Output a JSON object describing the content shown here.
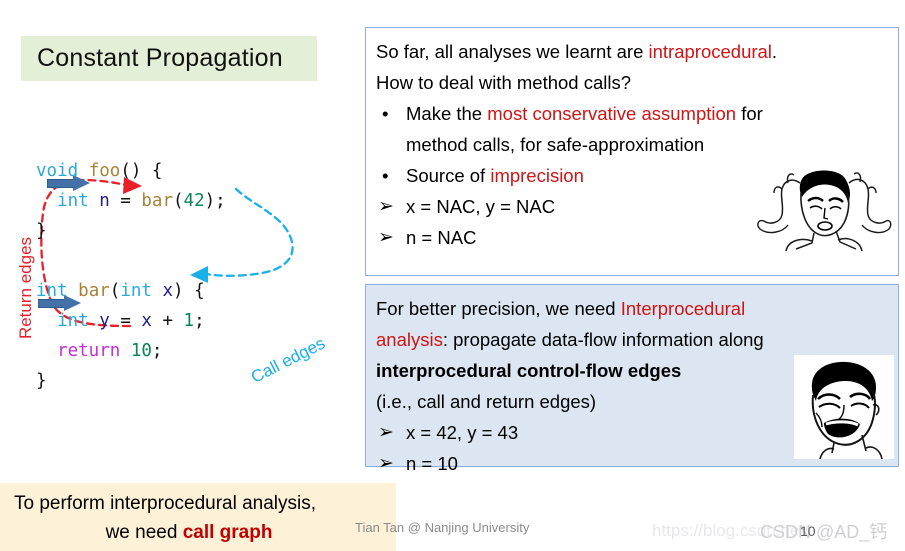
{
  "slide": {
    "title": "Constant Propagation",
    "page_number": "10"
  },
  "code": {
    "lines": [
      {
        "tokens": [
          {
            "t": "void",
            "c": "kw"
          },
          {
            "t": " ",
            "c": "pl"
          },
          {
            "t": "foo",
            "c": "fn"
          },
          {
            "t": "() {",
            "c": "pl"
          }
        ]
      },
      {
        "tokens": [
          {
            "t": "int",
            "c": "kw"
          },
          {
            "t": " ",
            "c": "pl"
          },
          {
            "t": "n",
            "c": "var"
          },
          {
            "t": " = ",
            "c": "pl"
          },
          {
            "t": "bar",
            "c": "fn"
          },
          {
            "t": "(",
            "c": "pl"
          },
          {
            "t": "42",
            "c": "num"
          },
          {
            "t": ");",
            "c": "pl"
          }
        ]
      },
      {
        "tokens": [
          {
            "t": "}",
            "c": "pl"
          }
        ]
      },
      {
        "tokens": []
      },
      {
        "tokens": [
          {
            "t": "int",
            "c": "kw"
          },
          {
            "t": " ",
            "c": "pl"
          },
          {
            "t": "bar",
            "c": "fn"
          },
          {
            "t": "(",
            "c": "pl"
          },
          {
            "t": "int",
            "c": "kw"
          },
          {
            "t": " ",
            "c": "pl"
          },
          {
            "t": "x",
            "c": "var"
          },
          {
            "t": ") {",
            "c": "pl"
          }
        ]
      },
      {
        "tokens": [
          {
            "t": "int",
            "c": "kw"
          },
          {
            "t": " ",
            "c": "pl"
          },
          {
            "t": "y",
            "c": "var"
          },
          {
            "t": " = ",
            "c": "pl"
          },
          {
            "t": "x",
            "c": "var"
          },
          {
            "t": " + ",
            "c": "pl"
          },
          {
            "t": "1",
            "c": "num"
          },
          {
            "t": ";",
            "c": "pl"
          }
        ]
      },
      {
        "tokens": [
          {
            "t": "return",
            "c": "ret"
          },
          {
            "t": " ",
            "c": "pl"
          },
          {
            "t": "10",
            "c": "num"
          },
          {
            "t": ";",
            "c": "pl"
          }
        ]
      },
      {
        "tokens": [
          {
            "t": "}",
            "c": "pl"
          }
        ]
      }
    ],
    "return_edges_label": "Return edges",
    "call_edges_label": "Call edges",
    "return_edge_color": "#e8202a",
    "call_edge_color": "#18b0e8",
    "step_arrow_color": "#4472a8"
  },
  "box_intraprocedural": {
    "line1_a": "So far, all analyses we learnt are ",
    "line1_red": "intraprocedural",
    "line1_b": ".",
    "line2": "How to deal with method calls?",
    "bullets": [
      {
        "mark": "•",
        "mark_type": "dot",
        "text_a": "Make the ",
        "text_red": "most conservative assumption",
        "text_b": " for",
        "text_cont": "method calls, for safe-approximation"
      },
      {
        "mark": "•",
        "mark_type": "dot",
        "text_a": "Source of ",
        "text_red": "imprecision",
        "text_b": "",
        "text_cont": ""
      }
    ],
    "results": [
      {
        "mark": "➢",
        "text": "x = NAC, y = NAC"
      },
      {
        "mark": "➢",
        "text": "n = NAC"
      }
    ],
    "meme": "confused-jackie-chan-face"
  },
  "box_interprocedural": {
    "line1_a": "For better precision, we need ",
    "line1_red": "Interprocedural",
    "line2_red": "analysis",
    "line2_b": ": propagate data-flow information along",
    "line3_bold": "interprocedural control-flow edges",
    "line4": "(i.e., call and return edges)",
    "results": [
      {
        "mark": "➢",
        "text": "x = 42, y = 43"
      },
      {
        "mark": "➢",
        "text": "n = 10"
      }
    ],
    "meme": "laughing-yao-ming-face"
  },
  "bottom_banner": {
    "line1": "To perform interprocedural analysis,",
    "line2_a": "we need ",
    "line2_highlight": "call graph"
  },
  "attribution": "Tian Tan @ Nanjing University",
  "watermark": {
    "url": "https://blog.csdn.net/",
    "csdn": "CSDN @AD_钙"
  },
  "colors": {
    "title_bg": "#e3efd7",
    "box_border": "#8faadc",
    "box_interprocedural_bg": "#dce6f2",
    "banner_bg": "#fdf2d7",
    "accent_red": "#d01414",
    "call_graph_red": "#c00000"
  }
}
